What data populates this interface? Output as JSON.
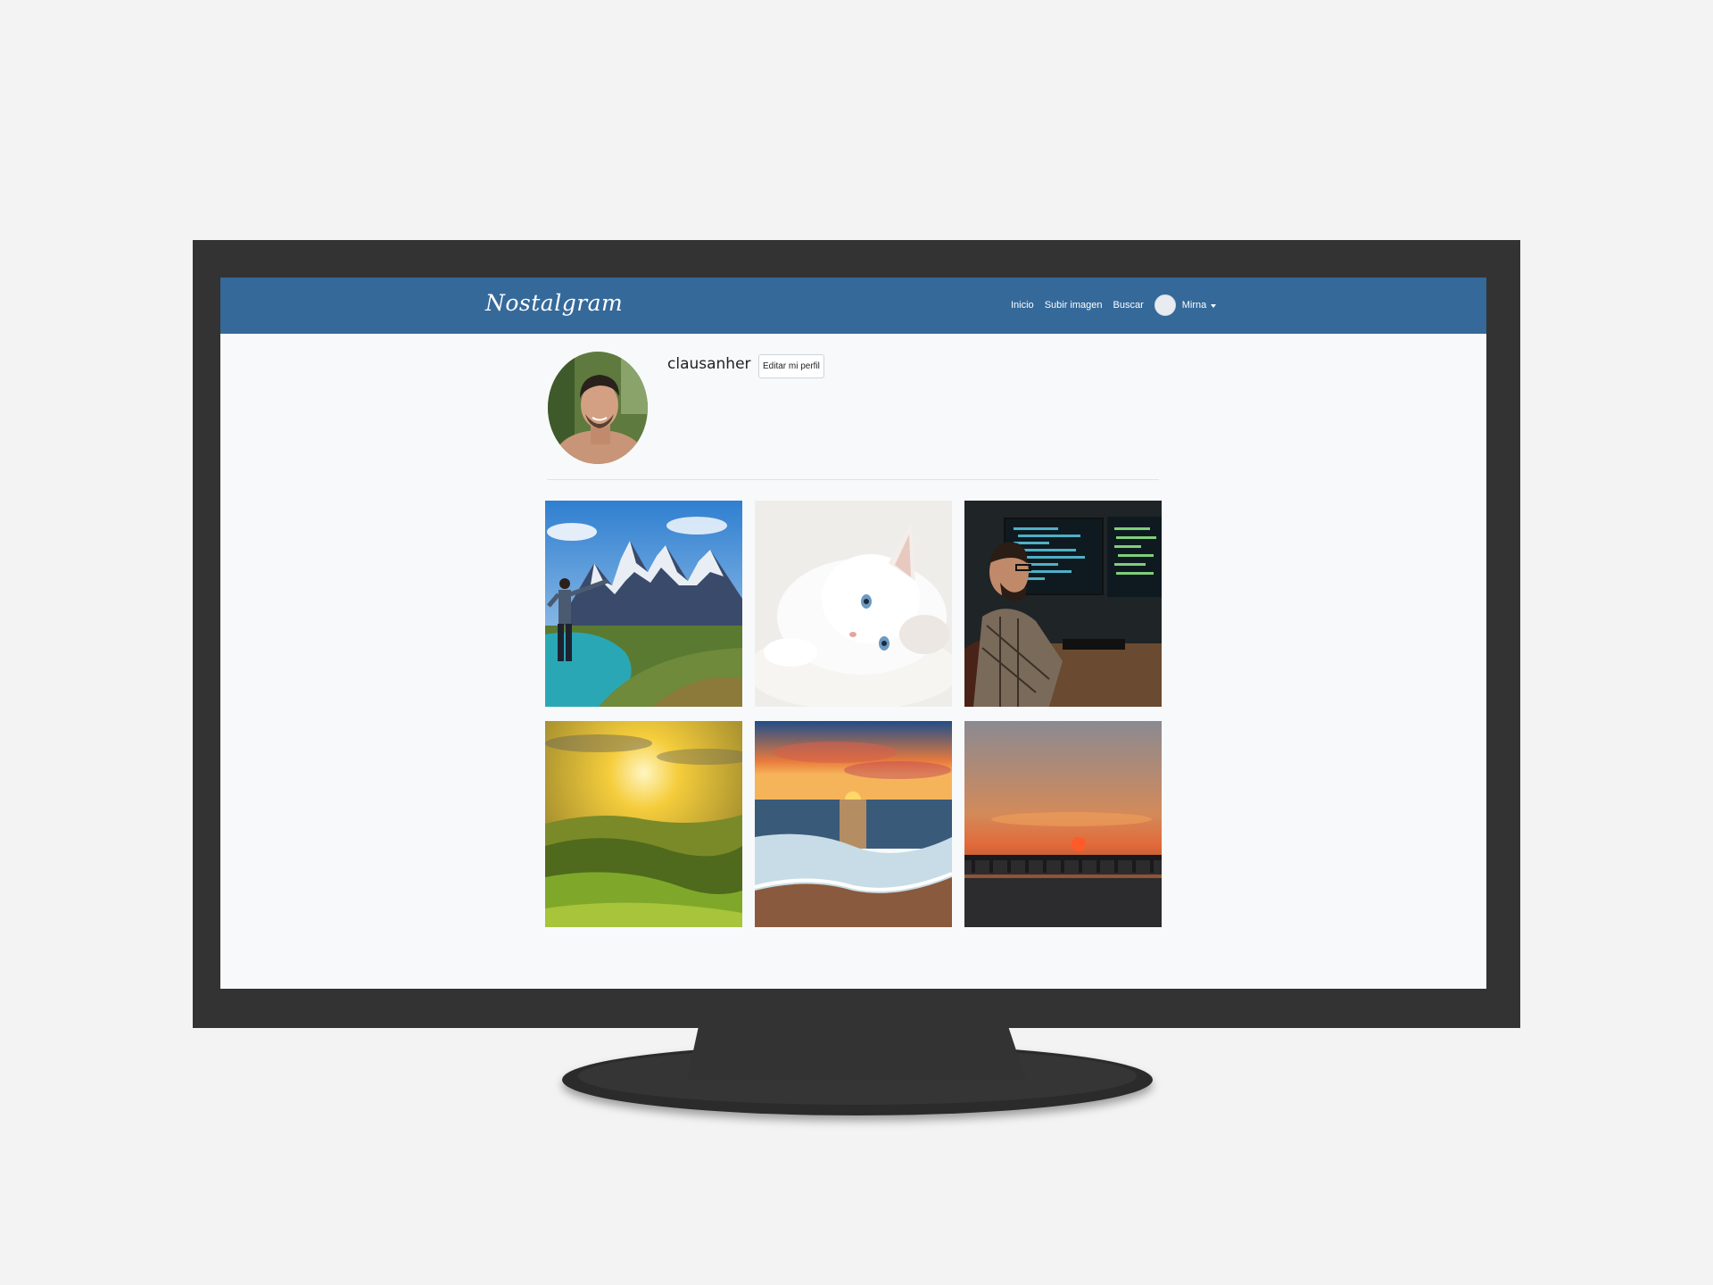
{
  "navbar": {
    "brand": "Nostalgram",
    "links": [
      "Inicio",
      "Subir imagen",
      "Buscar"
    ],
    "user_name": "Mirna",
    "background": "#35699a"
  },
  "profile": {
    "username": "clausanher",
    "edit_button": "Editar mi perfil"
  },
  "photos": [
    {
      "subject": "mountain-hiker"
    },
    {
      "subject": "white-kitten"
    },
    {
      "subject": "programmer-at-monitors"
    },
    {
      "subject": "sunrise-green-hills"
    },
    {
      "subject": "sunset-ocean-wave"
    },
    {
      "subject": "sunset-pier"
    }
  ]
}
